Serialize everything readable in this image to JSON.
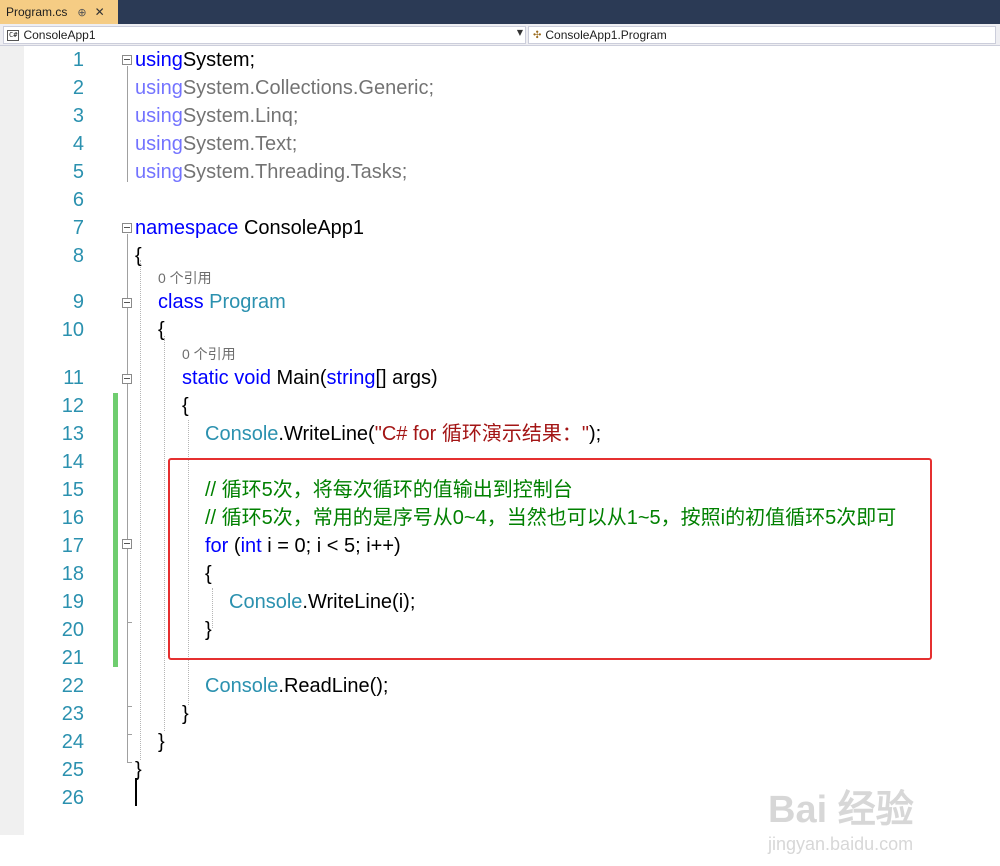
{
  "tab": {
    "title": "Program.cs",
    "pin": "⊕",
    "close": "✕"
  },
  "navbar": {
    "project": "ConsoleApp1",
    "member": "ConsoleApp1.Program",
    "dropdown": "▼"
  },
  "codelens": {
    "class_refs": "0 个引用",
    "method_refs": "0 个引用"
  },
  "lines": [
    {
      "num": "1",
      "parts": [
        [
          "kw",
          "using"
        ],
        [
          "",
          "System;"
        ]
      ]
    },
    {
      "num": "2",
      "parts": [
        [
          "kw",
          "using"
        ],
        [
          "",
          "System.Collections.Generic;"
        ]
      ]
    },
    {
      "num": "3",
      "parts": [
        [
          "kw",
          "using"
        ],
        [
          "",
          "System.Linq;"
        ]
      ]
    },
    {
      "num": "4",
      "parts": [
        [
          "kw",
          "using"
        ],
        [
          "",
          "System.Text;"
        ]
      ]
    },
    {
      "num": "5",
      "parts": [
        [
          "kw",
          "using"
        ],
        [
          "",
          "System.Threading.Tasks;"
        ]
      ]
    },
    {
      "num": "6",
      "parts": []
    },
    {
      "num": "7",
      "parts": [
        [
          "kw",
          "namespace"
        ],
        [
          "",
          " ConsoleApp1"
        ]
      ]
    },
    {
      "num": "8",
      "parts": [
        [
          "",
          "{"
        ]
      ]
    },
    {
      "num": "9",
      "parts": [
        [
          "kw",
          "class"
        ],
        [
          "",
          " "
        ],
        [
          "ty",
          "Program"
        ]
      ]
    },
    {
      "num": "10",
      "parts": [
        [
          "",
          "{"
        ]
      ]
    },
    {
      "num": "11",
      "parts": [
        [
          "kw",
          "static"
        ],
        [
          "",
          " "
        ],
        [
          "kw",
          "void"
        ],
        [
          "",
          " Main("
        ],
        [
          "kw",
          "string"
        ],
        [
          "",
          "[] args)"
        ]
      ]
    },
    {
      "num": "12",
      "parts": [
        [
          "",
          "{"
        ]
      ]
    },
    {
      "num": "13",
      "parts": [
        [
          "ty",
          "Console"
        ],
        [
          "",
          ".WriteLine("
        ],
        [
          "str",
          "\"C# for 循环演示结果：\""
        ],
        [
          "",
          ");"
        ]
      ]
    },
    {
      "num": "14",
      "parts": []
    },
    {
      "num": "15",
      "parts": [
        [
          "cm",
          "// 循环5次，将每次循环的值输出到控制台"
        ]
      ]
    },
    {
      "num": "16",
      "parts": [
        [
          "cm",
          "// 循环5次，常用的是序号从0~4，当然也可以从1~5，按照i的初值循环5次即可"
        ]
      ]
    },
    {
      "num": "17",
      "parts": [
        [
          "kw",
          "for"
        ],
        [
          "",
          " ("
        ],
        [
          "kw",
          "int"
        ],
        [
          "",
          " i = 0; i < 5; i++)"
        ]
      ]
    },
    {
      "num": "18",
      "parts": [
        [
          "",
          "{"
        ]
      ]
    },
    {
      "num": "19",
      "parts": [
        [
          "ty",
          "Console"
        ],
        [
          "",
          ".WriteLine(i);"
        ]
      ]
    },
    {
      "num": "20",
      "parts": [
        [
          "",
          "}"
        ]
      ]
    },
    {
      "num": "21",
      "parts": []
    },
    {
      "num": "22",
      "parts": [
        [
          "ty",
          "Console"
        ],
        [
          "",
          ".ReadLine();"
        ]
      ]
    },
    {
      "num": "23",
      "parts": [
        [
          "",
          "}"
        ]
      ]
    },
    {
      "num": "24",
      "parts": [
        [
          "",
          "}"
        ]
      ]
    },
    {
      "num": "25",
      "parts": [
        [
          "",
          "}"
        ]
      ]
    },
    {
      "num": "26",
      "parts": []
    }
  ],
  "watermark": {
    "brand": "Bai 经验",
    "url": "jingyan.baidu.com"
  }
}
